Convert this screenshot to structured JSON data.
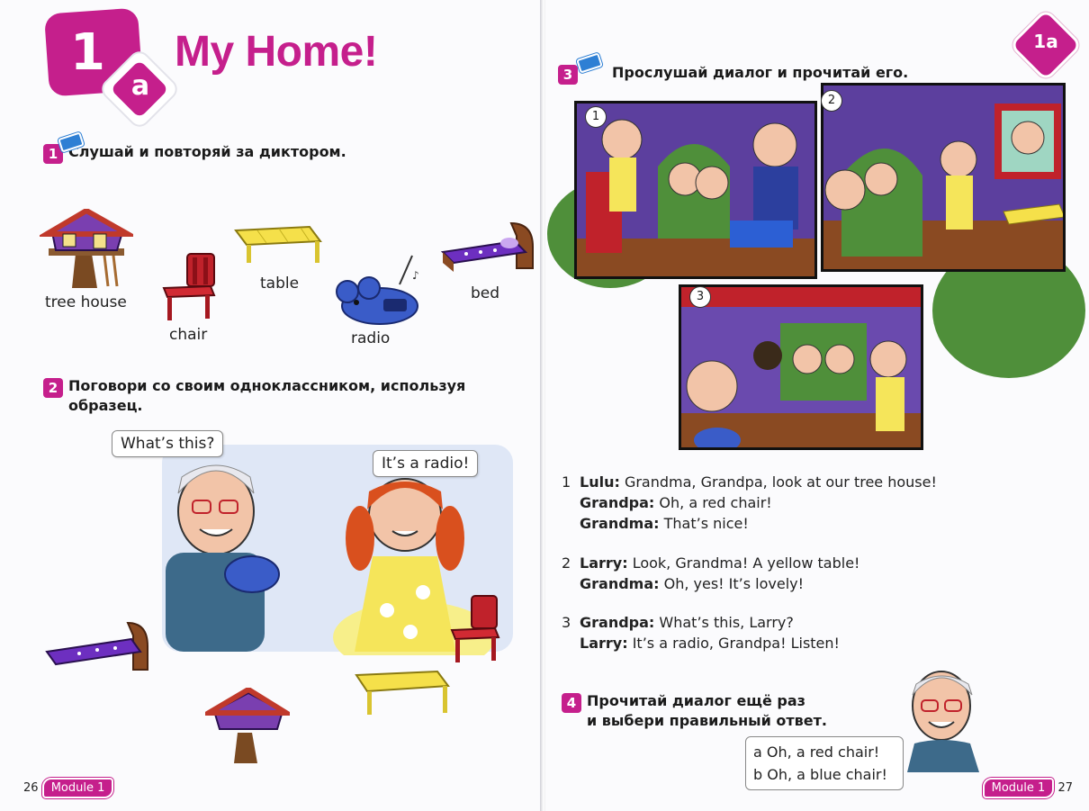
{
  "left_page": {
    "unit_number": "1",
    "unit_letter": "a",
    "title": "My Home!",
    "ex1": {
      "number": "1",
      "instruction": "Слушай и повторяй за диктором."
    },
    "vocabulary": {
      "tree_house": "tree house",
      "chair": "chair",
      "table": "table",
      "radio": "radio",
      "bed": "bed"
    },
    "ex2": {
      "number": "2",
      "instruction": "Поговори со своим одноклассником, используя образец."
    },
    "bubble_question": "What’s this?",
    "bubble_answer": "It’s a radio!",
    "footer": {
      "page": "26",
      "module": "Module 1"
    }
  },
  "right_page": {
    "corner_tag": "1a",
    "ex3": {
      "number": "3",
      "instruction": "Прослушай диалог и прочитай его."
    },
    "panels": [
      "1",
      "2",
      "3"
    ],
    "dialogues": [
      {
        "num": "1",
        "lines": [
          {
            "speaker": "Lulu:",
            "text": "Grandma, Grandpa, look at our tree house!"
          },
          {
            "speaker": "Grandpa:",
            "text": "Oh, a red chair!"
          },
          {
            "speaker": "Grandma:",
            "text": "That’s nice!"
          }
        ]
      },
      {
        "num": "2",
        "lines": [
          {
            "speaker": "Larry:",
            "text": "Look, Grandma! A yellow table!"
          },
          {
            "speaker": "Grandma:",
            "text": "Oh, yes! It’s lovely!"
          }
        ]
      },
      {
        "num": "3",
        "lines": [
          {
            "speaker": "Grandpa:",
            "text": "What’s this, Larry?"
          },
          {
            "speaker": "Larry:",
            "text": "It’s a radio, Grandpa! Listen!"
          }
        ]
      }
    ],
    "ex4": {
      "number": "4",
      "instruction_line1": "Прочитай диалог ещё раз",
      "instruction_line2": "и выбери правильный ответ."
    },
    "choices": [
      {
        "letter": "a",
        "text": "Oh, a red chair!"
      },
      {
        "letter": "b",
        "text": "Oh, a blue chair!"
      }
    ],
    "footer": {
      "page": "27",
      "module": "Module 1"
    }
  },
  "colors": {
    "accent": "#c51f8c",
    "cd_blue": "#2e7fd4",
    "wall_purple": "#5c3f9e",
    "leaf_green": "#4f8f3a"
  }
}
